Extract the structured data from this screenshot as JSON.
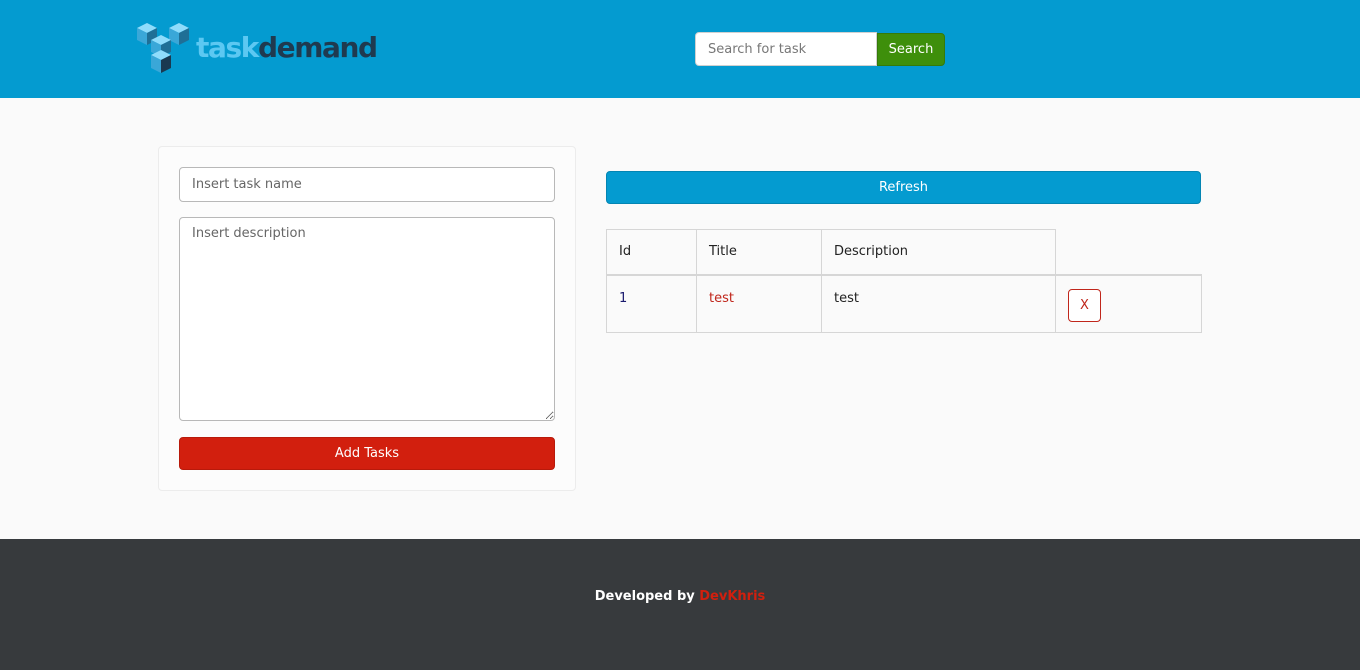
{
  "header": {
    "logo_text_part1": "task",
    "logo_text_part2": "demand",
    "search": {
      "placeholder": "Search for task",
      "button_label": "Search"
    }
  },
  "form": {
    "task_name_placeholder": "Insert task name",
    "description_placeholder": "Insert description",
    "add_button_label": "Add Tasks"
  },
  "tasks": {
    "refresh_label": "Refresh",
    "columns": [
      "Id",
      "Title",
      "Description"
    ],
    "rows": [
      {
        "id": "1",
        "title": "test",
        "description": "test",
        "delete_label": "X"
      }
    ]
  },
  "footer": {
    "prefix": "Developed by ",
    "author": "DevKhris"
  },
  "colors": {
    "header_bg": "#049bd0",
    "search_button": "#3e8f0b",
    "add_button": "#d21f0e",
    "footer_bg": "#373a3d",
    "accent_red": "#c0261b"
  },
  "icons": {
    "logo_icon": "stacked-cubes-icon",
    "delete_icon": "x"
  }
}
